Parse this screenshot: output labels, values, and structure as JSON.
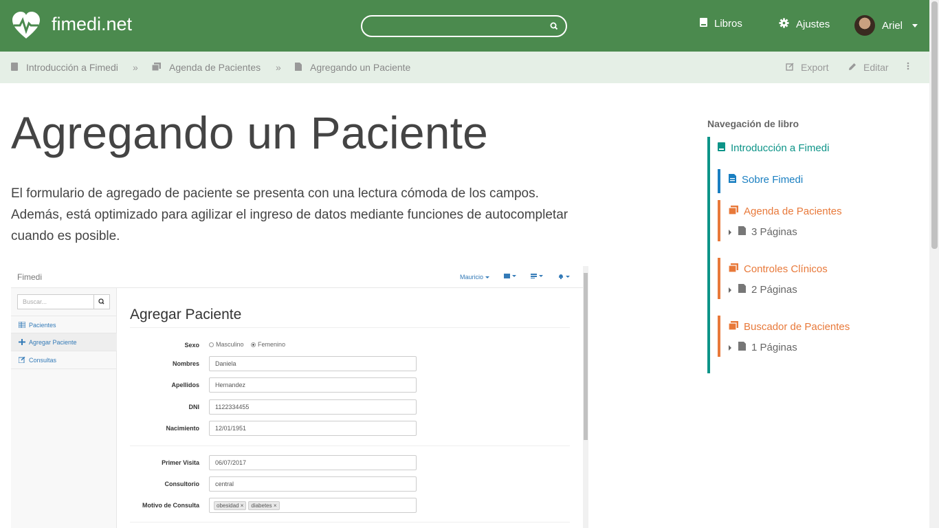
{
  "header": {
    "site_name": "fimedi.net",
    "search_placeholder": "",
    "nav": {
      "books_label": "Libros",
      "settings_label": "Ajustes"
    },
    "user": {
      "name": "Ariel"
    },
    "colors": {
      "header_bg": "#4b8a4e"
    }
  },
  "breadcrumb": {
    "items": [
      "Introducción a Fimedi",
      "Agenda de Pacientes",
      "Agregando un Paciente"
    ],
    "separator": "»",
    "actions": {
      "export_label": "Export",
      "edit_label": "Editar"
    }
  },
  "page": {
    "title": "Agregando un Paciente",
    "intro": "El formulario de agregado de paciente se presenta con una lectura cómoda de los campos. Además, está optimizado para agilizar el ingreso de datos mediante funciones de autocompletar cuando es posible."
  },
  "screenshot": {
    "brand": "Fimedi",
    "top_user": "Mauricio",
    "search_placeholder": "Buscar...",
    "sidebar": [
      "Pacientes",
      "Agregar Paciente",
      "Consultas"
    ],
    "heading": "Agregar Paciente",
    "form": {
      "sexo_label": "Sexo",
      "sexo_options": [
        "Masculino",
        "Femenino"
      ],
      "nombres_label": "Nombres",
      "nombres_value": "Daniela",
      "apellidos_label": "Apellidos",
      "apellidos_value": "Hernandez",
      "dni_label": "DNI",
      "dni_value": "1122334455",
      "nacimiento_label": "Nacimiento",
      "nacimiento_value": "12/01/1951",
      "primer_visita_label": "Primer Visita",
      "primer_visita_value": "06/07/2017",
      "consultorio_label": "Consultorio",
      "consultorio_value": "central",
      "motivo_label": "Motivo de Consulta",
      "motivo_tags": [
        "obesidad ×",
        "diabetes ×"
      ]
    }
  },
  "book_nav": {
    "title": "Navegación de libro",
    "items": [
      {
        "label": "Introducción a Fimedi",
        "color": "#0d9488"
      },
      {
        "label": "Sobre Fimedi",
        "color": "#1a7fc1"
      },
      {
        "label": "Agenda de Pacientes",
        "color": "#e8793a",
        "pages": "3 Páginas"
      },
      {
        "label": "Controles Clínicos",
        "color": "#e8793a",
        "pages": "2 Páginas"
      },
      {
        "label": "Buscador de Pacientes",
        "color": "#e8793a",
        "pages": "1 Páginas"
      }
    ]
  }
}
